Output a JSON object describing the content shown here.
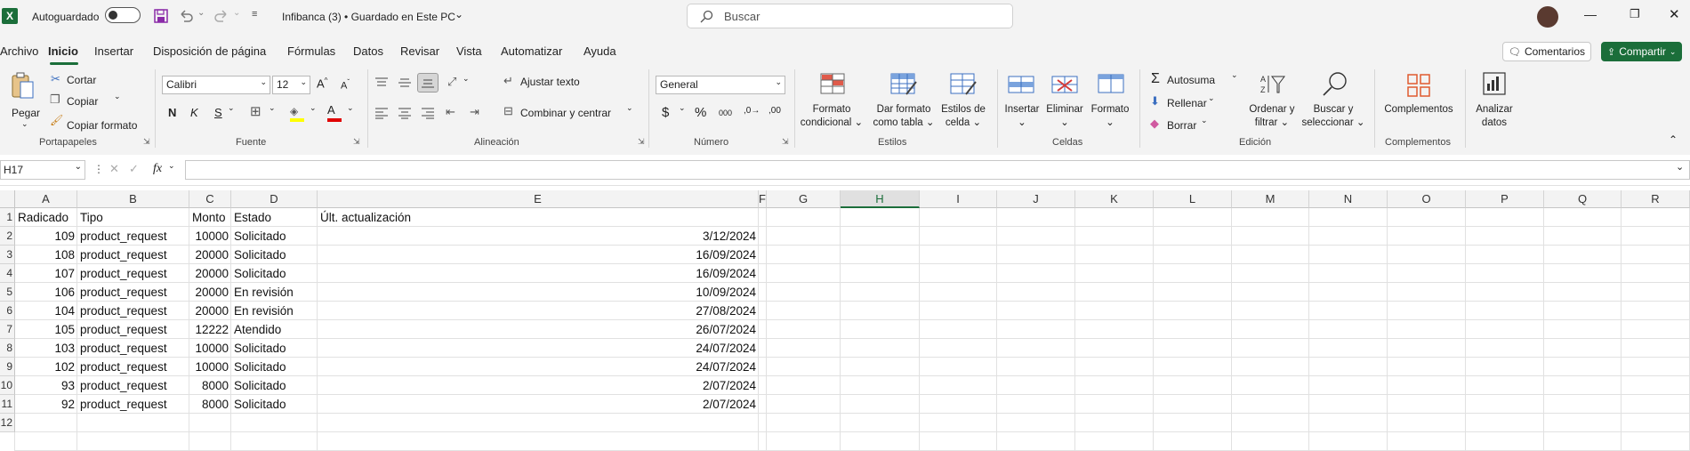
{
  "titlebar": {
    "autosave_label": "Autoguardado",
    "doc_title": "Infibanca (3) • Guardado en Este PC",
    "search_placeholder": "Buscar"
  },
  "menu": {
    "tabs": [
      "Archivo",
      "Inicio",
      "Insertar",
      "Disposición de página",
      "Fórmulas",
      "Datos",
      "Revisar",
      "Vista",
      "Automatizar",
      "Ayuda"
    ],
    "active_tab": "Inicio",
    "comments_label": "Comentarios",
    "share_label": "Compartir"
  },
  "ribbon": {
    "clipboard": {
      "paste": "Pegar",
      "cut": "Cortar",
      "copy": "Copiar",
      "format_painter": "Copiar formato",
      "label": "Portapapeles"
    },
    "font": {
      "name": "Calibri",
      "size": "12",
      "bold": "N",
      "italic": "K",
      "underline": "S",
      "label": "Fuente"
    },
    "alignment": {
      "wrap": "Ajustar texto",
      "merge": "Combinar y centrar",
      "label": "Alineación"
    },
    "number": {
      "format": "General",
      "currency": "$",
      "percent": "%",
      "thousands": "000",
      "label": "Número"
    },
    "styles": {
      "conditional_1": "Formato",
      "conditional_2": "condicional",
      "table_1": "Dar formato",
      "table_2": "como tabla",
      "cell_1": "Estilos de",
      "cell_2": "celda",
      "label": "Estilos"
    },
    "cells": {
      "insert": "Insertar",
      "delete": "Eliminar",
      "format": "Formato",
      "label": "Celdas"
    },
    "editing": {
      "autosum": "Autosuma",
      "fill": "Rellenar",
      "clear": "Borrar",
      "sort_1": "Ordenar y",
      "sort_2": "filtrar",
      "find_1": "Buscar y",
      "find_2": "seleccionar",
      "label": "Edición"
    },
    "addins": {
      "addins": "Complementos",
      "label": "Complementos"
    },
    "analyze": {
      "analyze_1": "Analizar",
      "analyze_2": "datos"
    }
  },
  "formula_bar": {
    "name_box": "H17",
    "formula": "",
    "fx": "fx"
  },
  "sheet": {
    "columns": [
      "A",
      "B",
      "C",
      "D",
      "E",
      "F",
      "G",
      "H",
      "I",
      "J",
      "K",
      "L",
      "M",
      "N",
      "O",
      "P",
      "Q",
      "R"
    ],
    "row_numbers": [
      "1",
      "2",
      "3",
      "4",
      "5",
      "6",
      "7",
      "8",
      "9",
      "10",
      "11",
      "12"
    ],
    "header": [
      "Radicado",
      "Tipo",
      "Monto",
      "Estado",
      "Últ. actualización"
    ],
    "rows": [
      [
        "109",
        "product_request",
        "10000",
        "Solicitado",
        "3/12/2024"
      ],
      [
        "108",
        "product_request",
        "20000",
        "Solicitado",
        "16/09/2024"
      ],
      [
        "107",
        "product_request",
        "20000",
        "Solicitado",
        "16/09/2024"
      ],
      [
        "106",
        "product_request",
        "20000",
        "En revisión",
        "10/09/2024"
      ],
      [
        "104",
        "product_request",
        "20000",
        "En revisión",
        "27/08/2024"
      ],
      [
        "105",
        "product_request",
        "12222",
        "Atendido",
        "26/07/2024"
      ],
      [
        "103",
        "product_request",
        "10000",
        "Solicitado",
        "24/07/2024"
      ],
      [
        "102",
        "product_request",
        "10000",
        "Solicitado",
        "24/07/2024"
      ],
      [
        "93",
        "product_request",
        "8000",
        "Solicitado",
        "2/07/2024"
      ],
      [
        "92",
        "product_request",
        "8000",
        "Solicitado",
        "2/07/2024"
      ]
    ]
  }
}
